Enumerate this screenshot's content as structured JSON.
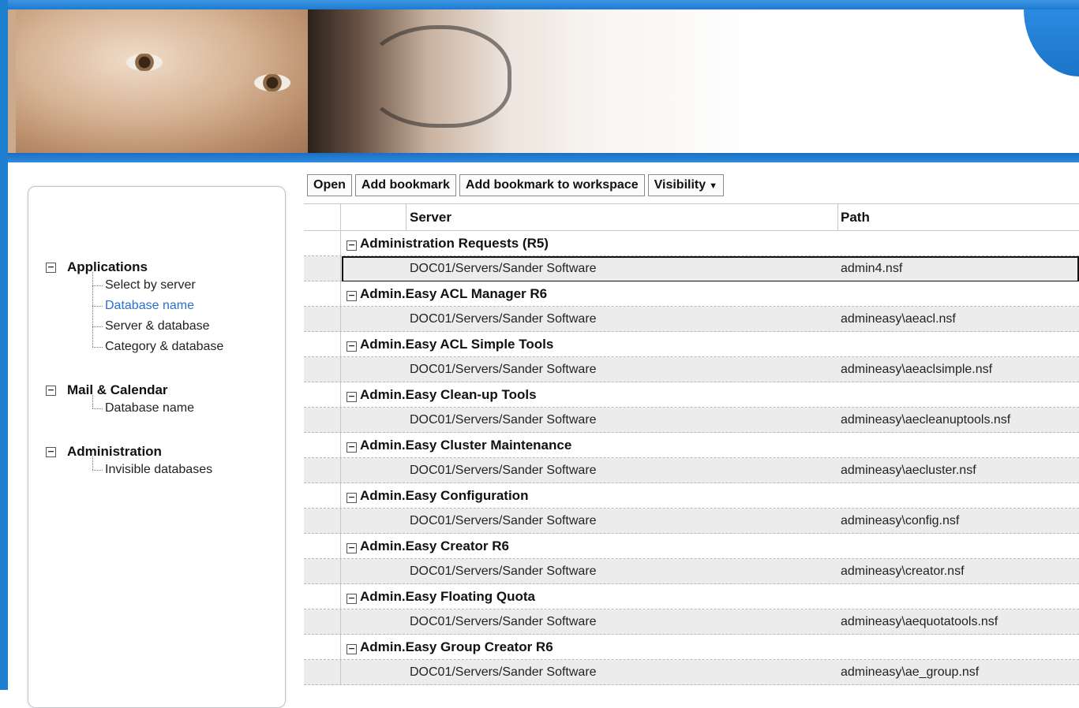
{
  "toolbar": {
    "open": "Open",
    "add_bookmark": "Add bookmark",
    "add_bookmark_workspace": "Add bookmark to workspace",
    "visibility": "Visibility"
  },
  "columns": {
    "server": "Server",
    "path": "Path"
  },
  "sidebar": {
    "groups": [
      {
        "title": "Applications",
        "items": [
          "Select by server",
          "Database name",
          "Server & database",
          "Category & database"
        ],
        "active": "Database name"
      },
      {
        "title": "Mail & Calendar",
        "items": [
          "Database name"
        ]
      },
      {
        "title": "Administration",
        "items": [
          "Invisible databases"
        ]
      }
    ]
  },
  "rows": [
    {
      "category": "Administration Requests (R5)",
      "server": "DOC01/Servers/Sander Software",
      "path": "admin4.nsf",
      "selected": true
    },
    {
      "category": "Admin.Easy ACL Manager R6",
      "server": "DOC01/Servers/Sander Software",
      "path": "admineasy\\aeacl.nsf"
    },
    {
      "category": "Admin.Easy ACL Simple Tools",
      "server": "DOC01/Servers/Sander Software",
      "path": "admineasy\\aeaclsimple.nsf"
    },
    {
      "category": "Admin.Easy Clean-up Tools",
      "server": "DOC01/Servers/Sander Software",
      "path": "admineasy\\aecleanuptools.nsf"
    },
    {
      "category": "Admin.Easy Cluster Maintenance",
      "server": "DOC01/Servers/Sander Software",
      "path": "admineasy\\aecluster.nsf"
    },
    {
      "category": "Admin.Easy Configuration",
      "server": "DOC01/Servers/Sander Software",
      "path": "admineasy\\config.nsf"
    },
    {
      "category": "Admin.Easy Creator R6",
      "server": "DOC01/Servers/Sander Software",
      "path": "admineasy\\creator.nsf"
    },
    {
      "category": "Admin.Easy Floating Quota",
      "server": "DOC01/Servers/Sander Software",
      "path": "admineasy\\aequotatools.nsf"
    },
    {
      "category": "Admin.Easy Group Creator R6",
      "server": "DOC01/Servers/Sander Software",
      "path": "admineasy\\ae_group.nsf"
    }
  ]
}
